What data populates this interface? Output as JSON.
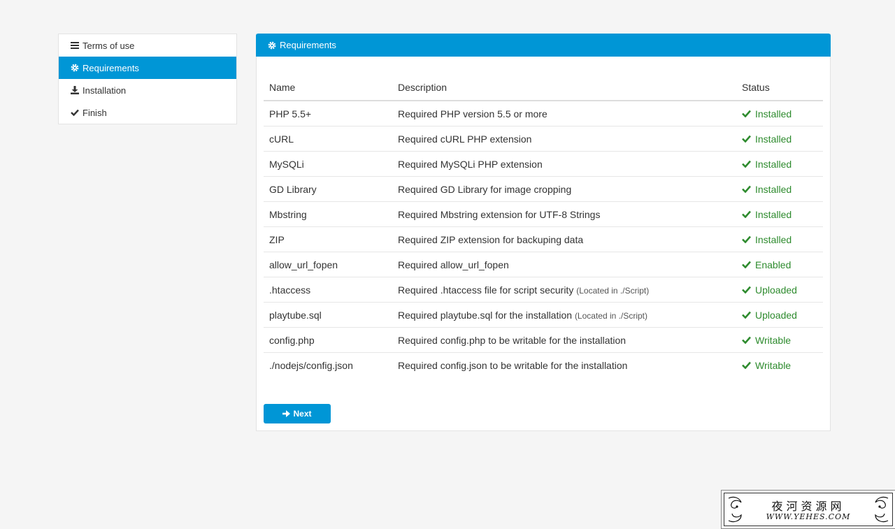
{
  "sidebar": {
    "items": [
      {
        "label": "Terms of use",
        "icon": "list-icon",
        "active": false
      },
      {
        "label": "Requirements",
        "icon": "gear-icon",
        "active": true
      },
      {
        "label": "Installation",
        "icon": "download-icon",
        "active": false
      },
      {
        "label": "Finish",
        "icon": "check-icon",
        "active": false
      }
    ]
  },
  "panel": {
    "title": "Requirements",
    "table": {
      "headers": [
        "Name",
        "Description",
        "Status"
      ],
      "rows": [
        {
          "name": "PHP 5.5+",
          "description": "Required PHP version 5.5 or more",
          "note": "",
          "status": "Installed"
        },
        {
          "name": "cURL",
          "description": "Required cURL PHP extension",
          "note": "",
          "status": "Installed"
        },
        {
          "name": "MySQLi",
          "description": "Required MySQLi PHP extension",
          "note": "",
          "status": "Installed"
        },
        {
          "name": "GD Library",
          "description": "Required GD Library for image cropping",
          "note": "",
          "status": "Installed"
        },
        {
          "name": "Mbstring",
          "description": "Required Mbstring extension for UTF-8 Strings",
          "note": "",
          "status": "Installed"
        },
        {
          "name": "ZIP",
          "description": "Required ZIP extension for backuping data",
          "note": "",
          "status": "Installed"
        },
        {
          "name": "allow_url_fopen",
          "description": "Required allow_url_fopen",
          "note": "",
          "status": "Enabled"
        },
        {
          "name": ".htaccess",
          "description": "Required .htaccess file for script security",
          "note": "(Located in ./Script)",
          "status": "Uploaded"
        },
        {
          "name": "playtube.sql",
          "description": "Required playtube.sql for the installation",
          "note": "(Located in ./Script)",
          "status": "Uploaded"
        },
        {
          "name": "config.php",
          "description": "Required config.php to be writable for the installation",
          "note": "",
          "status": "Writable"
        },
        {
          "name": "./nodejs/config.json",
          "description": "Required config.json to be writable for the installation",
          "note": "",
          "status": "Writable"
        }
      ]
    },
    "next_label": "Next"
  },
  "watermark": {
    "title": "夜河资源网",
    "url": "WWW.YEHES.COM"
  },
  "colors": {
    "accent": "#0096d6",
    "success": "#2e8b2e",
    "background": "#f5f5f5"
  }
}
